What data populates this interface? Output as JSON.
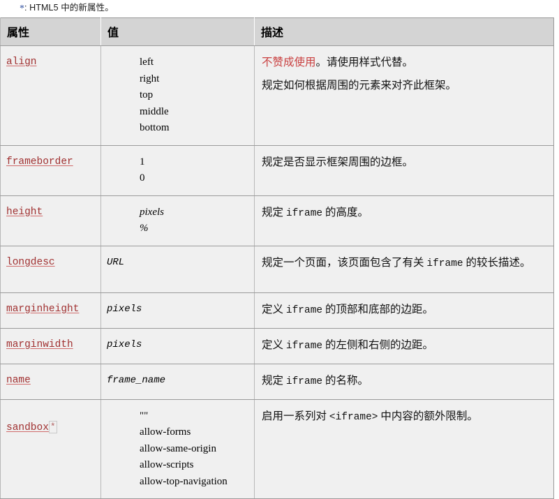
{
  "note": {
    "star": "*",
    "text": ": HTML5 中的新属性。"
  },
  "table": {
    "headers": [
      "属性",
      "值",
      "描述"
    ],
    "rows": [
      {
        "attr": "align",
        "attr_star": "",
        "values": [
          "left",
          "right",
          "top",
          "middle",
          "bottom"
        ],
        "value_style": "indent",
        "desc_deprecated": "不赞成使用",
        "desc_line1_rest": "。请使用样式代替。",
        "desc_line2": "规定如何根据周围的元素来对齐此框架。"
      },
      {
        "attr": "frameborder",
        "attr_star": "",
        "values": [
          "1",
          "0"
        ],
        "value_style": "indent",
        "desc_line1": "规定是否显示框架周围的边框。"
      },
      {
        "attr": "height",
        "attr_star": "",
        "values": [
          "pixels",
          "%"
        ],
        "value_style": "indent-italic",
        "desc_pre": "规定 ",
        "desc_code": "iframe",
        "desc_post": " 的高度。"
      },
      {
        "attr": "longdesc",
        "attr_star": "",
        "values": [
          "URL"
        ],
        "value_style": "flush-italic",
        "desc_pre": "规定一个页面，该页面包含了有关 ",
        "desc_code": "iframe",
        "desc_post": " 的较长描述。"
      },
      {
        "attr": "marginheight",
        "attr_star": "",
        "values": [
          "pixels"
        ],
        "value_style": "flush-italic",
        "desc_pre": "定义 ",
        "desc_code": "iframe",
        "desc_post": " 的顶部和底部的边距。"
      },
      {
        "attr": "marginwidth",
        "attr_star": "",
        "values": [
          "pixels"
        ],
        "value_style": "flush-italic",
        "desc_pre": "定义 ",
        "desc_code": "iframe",
        "desc_post": " 的左侧和右侧的边距。"
      },
      {
        "attr": "name",
        "attr_star": "",
        "values": [
          "frame_name"
        ],
        "value_style": "flush-italic-mono",
        "desc_pre": "规定 ",
        "desc_code": "iframe",
        "desc_post": " 的名称。"
      },
      {
        "attr": "sandbox",
        "attr_star": "*",
        "values": [
          "\"\"",
          "allow-forms",
          "allow-same-origin",
          "allow-scripts",
          "allow-top-navigation"
        ],
        "value_style": "indent",
        "desc_pre": "启用一系列对 ",
        "desc_code": "<iframe>",
        "desc_post": " 中内容的额外限制。"
      }
    ]
  }
}
